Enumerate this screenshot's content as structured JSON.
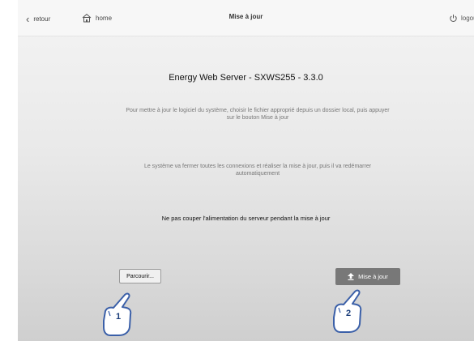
{
  "topbar": {
    "back_label": "retour",
    "back_icon": "chevron-left-icon",
    "home_label": "home",
    "home_icon": "home-icon",
    "title": "Mise à jour",
    "logout_label": "logout",
    "logout_icon": "power-icon"
  },
  "main": {
    "heading": "Energy Web Server - SXWS255 - 3.3.0",
    "instructions": "Pour mettre à jour le logiciel du système, choisir le fichier approprié depuis un dossier local, puis appuyer sur le bouton Mise à jour",
    "info": "Le système va fermer toutes les connexions et réaliser la mise à jour, puis il va redémarrer automatiquement",
    "warning": "Ne pas couper l'alimentation du serveur pendant la mise à jour",
    "browse_button_label": "Parcourir...",
    "update_button_label": "Mise à jour",
    "update_button_icon": "upload-arrow-icon"
  },
  "annotations": {
    "step1": "1",
    "step2": "2",
    "accent_color": "#1a3d7a"
  }
}
